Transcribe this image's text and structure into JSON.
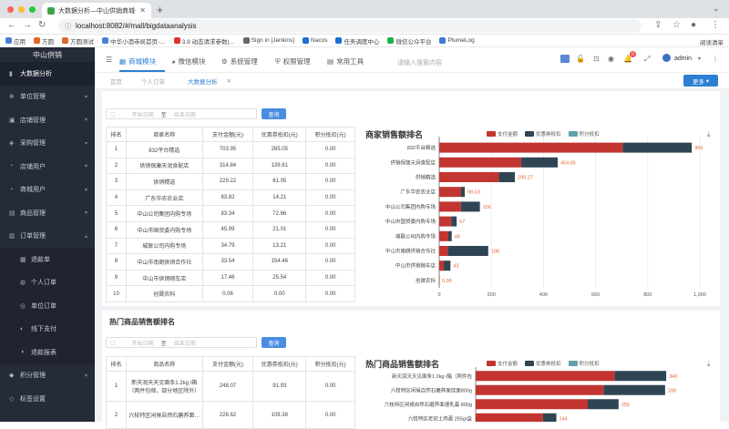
{
  "browser": {
    "tab_title": "大数据分析—中山供销商城-管",
    "url": "localhost:8082/#/mall/bigdataanalysis",
    "bookmarks": [
      "应用",
      "方圆",
      "方圆测试",
      "中华小酒寺局首页-…",
      "3.9 动态请求参数|…",
      "Sign in [Jenkins]",
      "Nacos",
      "任务调度中心",
      "微信公众平台",
      "PlumeLog"
    ],
    "reading_list": "阅读清单"
  },
  "sidebar": {
    "brand": "中山供销",
    "items": [
      {
        "label": "大数据分析",
        "icon": "chart-icon",
        "active": true
      },
      {
        "label": "单位管理",
        "icon": "org-icon",
        "arrow": true
      },
      {
        "label": "店铺管理",
        "icon": "shop-icon",
        "arrow": true
      },
      {
        "label": "采购管理",
        "icon": "purchase-icon",
        "arrow": true
      },
      {
        "label": "店铺用户",
        "icon": "user-icon",
        "arrow": true
      },
      {
        "label": "商城用户",
        "icon": "user-icon",
        "arrow": true
      },
      {
        "label": "商品管理",
        "icon": "goods-icon",
        "arrow": true
      },
      {
        "label": "订单管理",
        "icon": "order-icon",
        "arrow": true,
        "expanded": true
      },
      {
        "label": "退款单",
        "icon": "refund-icon",
        "sub": true
      },
      {
        "label": "个人订单",
        "icon": "person-icon",
        "sub": true
      },
      {
        "label": "单位订单",
        "icon": "company-icon",
        "sub": true
      },
      {
        "label": "线下支付",
        "icon": "pay-icon",
        "sub": true
      },
      {
        "label": "退款报表",
        "icon": "report-icon",
        "sub": true
      },
      {
        "label": "积分管理",
        "icon": "points-icon",
        "arrow": true
      },
      {
        "label": "标签设置",
        "icon": "tag-icon",
        "arrow": false
      }
    ]
  },
  "header": {
    "menus": [
      {
        "label": "商城模块",
        "icon": "grid-icon",
        "active": true
      },
      {
        "label": "微信模块",
        "icon": "wechat-icon"
      },
      {
        "label": "系统管理",
        "icon": "gear-icon"
      },
      {
        "label": "权限管理",
        "icon": "shield-icon"
      },
      {
        "label": "常用工具",
        "icon": "tool-icon"
      }
    ],
    "search_placeholder": "请输入搜索内容",
    "badge_count": "0",
    "user": "admin"
  },
  "tabs": {
    "items": [
      "首页",
      "个人订单",
      "大数据分析"
    ],
    "more": "更多"
  },
  "section1": {
    "title": "商家销售额排名",
    "date_start": "开始日期",
    "date_sep": "至",
    "date_end": "结束日期",
    "query": "查询",
    "columns": [
      "排名",
      "商家名称",
      "支付金额(元)",
      "优惠券抵扣(元)",
      "积分抵扣(元)"
    ],
    "rows": [
      [
        "1",
        "832平台精选",
        "703.95",
        "265.05",
        "0.00"
      ],
      [
        "2",
        "供销保康天润食配店",
        "314.84",
        "139.81",
        "0.00"
      ],
      [
        "3",
        "供销精选",
        "229.22",
        "61.05",
        "0.00"
      ],
      [
        "4",
        "广东华农农业店",
        "83.82",
        "14.21",
        "0.00"
      ],
      [
        "5",
        "中山公司集团内购专场",
        "83.34",
        "72.66",
        "0.00"
      ],
      [
        "6",
        "中山市国贸委内购专场",
        "45.99",
        "21.01",
        "0.00"
      ],
      [
        "7",
        "城联公司内购专场",
        "34.79",
        "13.21",
        "0.00"
      ],
      [
        "8",
        "中山市南朗供销合作社",
        "33.54",
        "154.46",
        "0.00"
      ],
      [
        "9",
        "中山市供销随车店",
        "17.46",
        "25.54",
        "0.00"
      ],
      [
        "10",
        "创晟农科",
        "0.06",
        "0.00",
        "0.00"
      ]
    ]
  },
  "section2": {
    "title": "热门商品销售额排名",
    "date_start": "开始日期",
    "date_sep": "至",
    "date_end": "结束日期",
    "query": "查询",
    "columns": [
      "排名",
      "商品名称",
      "支付金额(元)",
      "优惠券抵扣(元)",
      "积分抵扣(元)"
    ],
    "rows": [
      [
        "1",
        "新天润天天见面条1.2kg /箱（两件包邮，部分地区除外）",
        "248.07",
        "91.93",
        "0.00"
      ],
      [
        "2",
        "六枝特区闲候自然石磨荞面…",
        "228.62",
        "109.38",
        "0.00"
      ]
    ]
  },
  "chart_data": [
    {
      "type": "bar",
      "orientation": "horizontal",
      "stacked": true,
      "title": "商家销售额排名",
      "legend": [
        "支付金额",
        "优惠券抵扣",
        "积分抵扣"
      ],
      "colors": [
        "#c23531",
        "#2f4554",
        "#61a0a8"
      ],
      "categories": [
        "832平台精选",
        "供销保康天润食配店",
        "供销精选",
        "广东华农农业店",
        "中山公司集团内购专场",
        "中山市国贸委内购专场",
        "城联公司内购专场",
        "中山市南朗供销合作社",
        "中山市供销随车店",
        "创晟农科"
      ],
      "series": [
        {
          "name": "支付金额",
          "values": [
            703.95,
            314.84,
            229.22,
            83.82,
            83.34,
            45.99,
            34.79,
            33.54,
            17.46,
            0.06
          ]
        },
        {
          "name": "优惠券抵扣",
          "values": [
            265.05,
            139.81,
            61.05,
            14.21,
            72.66,
            21.01,
            13.21,
            154.46,
            25.54,
            0
          ]
        },
        {
          "name": "积分抵扣",
          "values": [
            0,
            0,
            0,
            0,
            0,
            0,
            0,
            0,
            0,
            0
          ]
        }
      ],
      "totals": [
        "969",
        "454.65",
        "290.27",
        "98.03",
        "156",
        "67",
        "48",
        "188",
        "43",
        "0.06"
      ],
      "xlim": [
        0,
        1000
      ],
      "xticks": [
        "0",
        "200",
        "400",
        "600",
        "800",
        "1,000"
      ]
    },
    {
      "type": "bar",
      "orientation": "horizontal",
      "stacked": true,
      "title": "热门商品销售额排名",
      "legend": [
        "支付金额",
        "优惠券抵扣",
        "积分抵扣"
      ],
      "colors": [
        "#c23531",
        "#2f4554",
        "#61a0a8"
      ],
      "categories": [
        "新天润天天见面条1.2kg /箱（两件包",
        "六枝特区闲候自然石磨荞面挂面800g",
        "六枝特区闲候自然石磨荞面速乳蛋 800g",
        "六枝特区老初土鸡蛋 255g/盒"
      ],
      "series": [
        {
          "name": "支付金额",
          "values": [
            248.07,
            228.62,
            200,
            120
          ]
        },
        {
          "name": "优惠券抵扣",
          "values": [
            91.93,
            109.38,
            55,
            24
          ]
        },
        {
          "name": "积分抵扣",
          "values": [
            0,
            0,
            0,
            0
          ]
        }
      ],
      "totals": [
        "340",
        "338",
        "255",
        "144"
      ],
      "xlim": [
        0,
        400
      ]
    }
  ]
}
